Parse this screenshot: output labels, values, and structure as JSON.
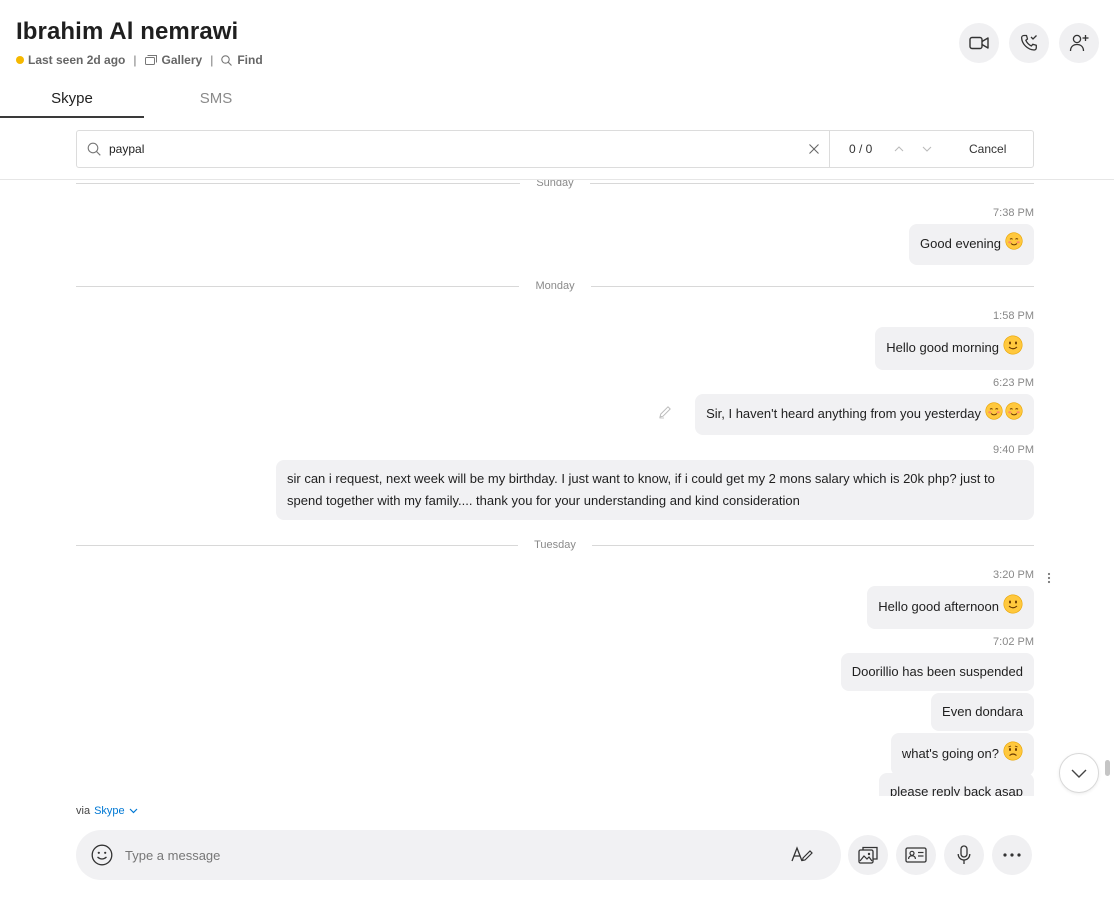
{
  "header": {
    "name": "Ibrahim Al nemrawi",
    "last_seen": "Last seen 2d ago",
    "gallery": "Gallery",
    "find": "Find",
    "separator": "|"
  },
  "tabs": [
    {
      "label": "Skype",
      "active": true
    },
    {
      "label": "SMS",
      "active": false
    }
  ],
  "find_bar": {
    "query": "paypal",
    "count": "0 / 0",
    "cancel": "Cancel"
  },
  "conversation": {
    "days": [
      "Sunday",
      "Monday",
      "Tuesday"
    ],
    "messages": [
      {
        "time": "7:38 PM",
        "text": "Good evening",
        "emoji": [
          "blush"
        ]
      },
      {
        "time": "1:58 PM",
        "text": "Hello good morning",
        "emoji": [
          "smile"
        ]
      },
      {
        "time": "6:23 PM",
        "text": "Sir, I haven't heard anything from you yesterday",
        "emoji": [
          "blush",
          "blush"
        ]
      },
      {
        "time": "9:40 PM",
        "text": "sir can i request, next week will be my birthday. I just want to know, if i could get my 2 mons salary which is 20k php? just to spend together with my family.... thank you for your understanding and kind consideration"
      },
      {
        "time": "3:20 PM",
        "text": "Hello good afternoon",
        "emoji": [
          "smile"
        ]
      },
      {
        "time": "7:02 PM",
        "text": "Doorillio has been suspended"
      },
      {
        "text": "Even dondara"
      },
      {
        "text": "what's going on?",
        "emoji": [
          "sad"
        ]
      },
      {
        "text": "please reply back asap"
      }
    ]
  },
  "composer": {
    "via_prefix": "via",
    "via_link": "Skype",
    "placeholder": "Type a message"
  },
  "colors": {
    "presence_away": "#f5b800",
    "bubble_bg": "#f1f1f3",
    "link": "#0078d4"
  }
}
